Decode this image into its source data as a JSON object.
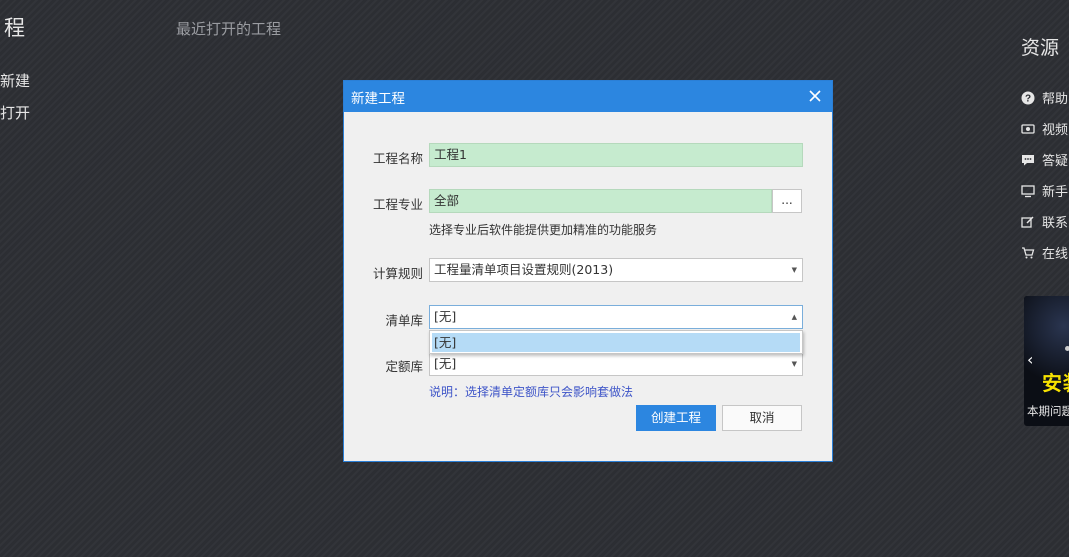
{
  "left": {
    "title": "程",
    "menu": [
      "新建",
      "打开"
    ]
  },
  "recent": {
    "title": "最近打开的工程"
  },
  "resources": {
    "title": "资源",
    "items": [
      {
        "label": "帮助",
        "icon": "help-icon"
      },
      {
        "label": "视频",
        "icon": "video-icon"
      },
      {
        "label": "答疑",
        "icon": "chat-icon"
      },
      {
        "label": "新手",
        "icon": "monitor-icon"
      },
      {
        "label": "联系",
        "icon": "edit-icon"
      },
      {
        "label": "在线",
        "icon": "cart-icon"
      }
    ],
    "banner": {
      "arrow": "‹",
      "text": "安装",
      "caption": "本期问题"
    }
  },
  "dialog": {
    "title": "新建工程",
    "project_name_label": "工程名称",
    "project_name_value": "工程1",
    "specialty_label": "工程专业",
    "specialty_value": "全部",
    "specialty_button": "...",
    "specialty_hint": "选择专业后软件能提供更加精准的功能服务",
    "calc_rule_label": "计算规则",
    "calc_rule_value": "工程量清单项目设置规则(2013)",
    "bill_lib_label": "清单库",
    "bill_lib_value": "[无]",
    "bill_lib_options": [
      "[无]"
    ],
    "quota_lib_label": "定额库",
    "quota_lib_value": "[无]",
    "note": "说明：选择清单定额库只会影响套做法",
    "create_button": "创建工程",
    "cancel_button": "取消"
  },
  "colors": {
    "accent": "#2c86e0",
    "field_green": "#c6ebcf",
    "dropdown_highlight": "#b5dbf6",
    "note_text": "#3e55c8",
    "banner_text": "#f7e200"
  }
}
